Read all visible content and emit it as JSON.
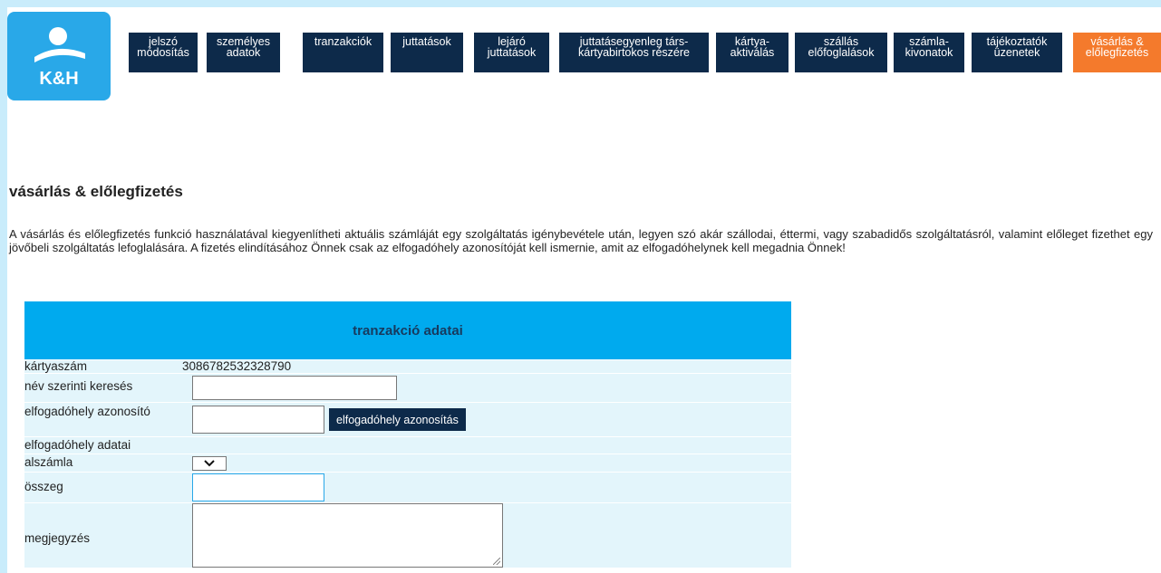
{
  "logo": {
    "text": "K&H"
  },
  "nav": [
    {
      "label": "jelszó\nmódosítás",
      "key": "password"
    },
    {
      "label": "személyes\nadatok",
      "key": "personal"
    },
    {
      "label": "tranzakciók",
      "key": "transactions"
    },
    {
      "label": "juttatások",
      "key": "benefits"
    },
    {
      "label": "lejáró\njuttatások",
      "key": "expiring"
    },
    {
      "label": "juttatásegyenleg társ-\nkártyabirtokos részére",
      "key": "cocardholder"
    },
    {
      "label": "kártya-\naktiválás",
      "key": "activation"
    },
    {
      "label": "szállás\nelőfoglalások",
      "key": "lodging"
    },
    {
      "label": "számla-\nkivonatok",
      "key": "statements"
    },
    {
      "label": "tájékoztatók\nüzenetek",
      "key": "messages"
    },
    {
      "label": "vásárlás &\nelőlegfizetés",
      "key": "purchase",
      "active": true
    }
  ],
  "page": {
    "title": "vásárlás & előlegfizetés",
    "intro": "A vásárlás és előlegfizetés funkció használatával kiegyenlítheti aktuális számláját egy szolgáltatás igénybevétele után, legyen szó akár szállodai, éttermi, vagy szabadidős szolgáltatásról, valamint előleget fizethet egy jövőbeli szolgáltatás lefoglalására. A fizetés elindításához Önnek csak az elfogadóhely azonosítóját kell ismernie, amit az elfogadóhelynek kell megadnia Önnek!"
  },
  "form": {
    "header": "tranzakció adatai",
    "card_label": "kártyaszám",
    "card_number": "3086782532328790",
    "name_search_label": "név szerinti keresés",
    "merchant_id_label": "elfogadóhely azonosító",
    "merchant_id_button": "elfogadóhely azonosítás",
    "merchant_data_label": "elfogadóhely adatai",
    "subaccount_label": "alszámla",
    "amount_label": "összeg",
    "note_label": "megjegyzés"
  }
}
